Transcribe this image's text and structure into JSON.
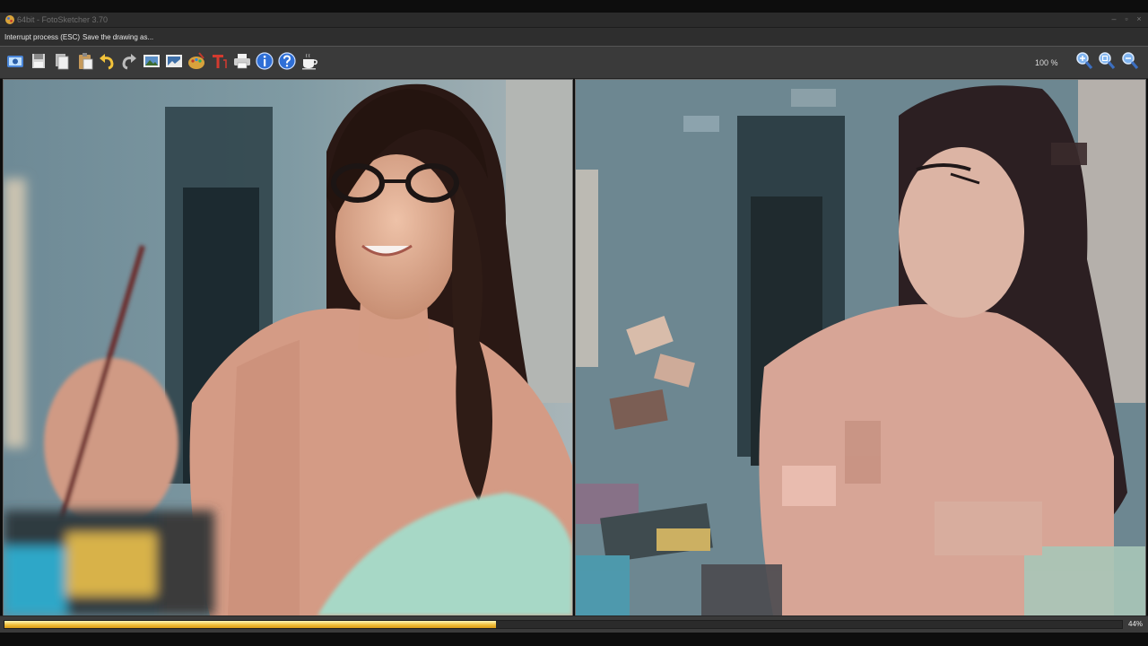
{
  "window": {
    "title": "64bit - FotoSketcher 3.70",
    "controls": [
      "minimize-icon",
      "restore-icon",
      "close-icon"
    ]
  },
  "infobar": {
    "interrupt_label": "Interrupt process (ESC)",
    "save_label": "Save the drawing as..."
  },
  "toolbar": {
    "buttons": [
      "open-image-icon",
      "save-icon",
      "copy-icon",
      "paste-icon",
      "undo-icon",
      "redo-icon",
      "original-image-icon",
      "drawing-icon",
      "palette-icon",
      "text-icon",
      "print-icon",
      "info-icon",
      "help-icon",
      "coffee-icon"
    ],
    "zoom_level": "100 %",
    "zoom_buttons": [
      "zoom-in-icon",
      "zoom-fit-icon",
      "zoom-out-icon"
    ]
  },
  "panels": {
    "original": "original-photo",
    "drawing": "painted-result"
  },
  "status": {
    "progress_value": 0.44,
    "progress_text": "44%"
  },
  "colors": {
    "accent": "#f1c03b",
    "toolbar_bg": "#3a3a3a",
    "window_bg": "#2e2e2e"
  }
}
